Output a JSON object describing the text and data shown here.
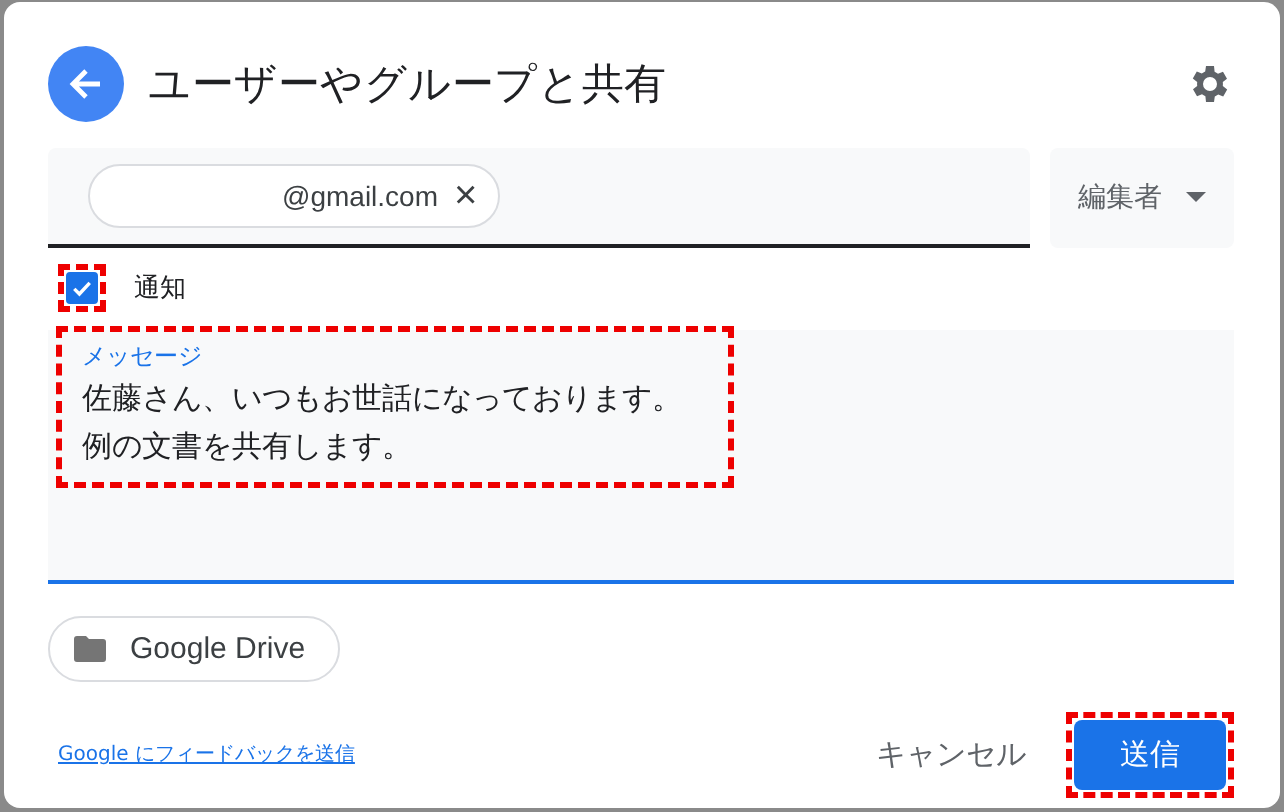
{
  "dialog": {
    "title": "ユーザーやグループと共有"
  },
  "recipient": {
    "chip_text": "@gmail.com",
    "remove": "×",
    "role": "編集者"
  },
  "notify": {
    "label": "通知",
    "checked": true,
    "highlighted": true
  },
  "message": {
    "label": "メッセージ",
    "lines": [
      "佐藤さん、いつもお世話になっております。",
      "例の文書を共有します。"
    ],
    "highlighted": true
  },
  "drive_button": "Google Drive",
  "feedback_link": "Google にフィードバックを送信",
  "buttons": {
    "cancel": "キャンセル",
    "send": "送信",
    "send_highlighted": true
  }
}
